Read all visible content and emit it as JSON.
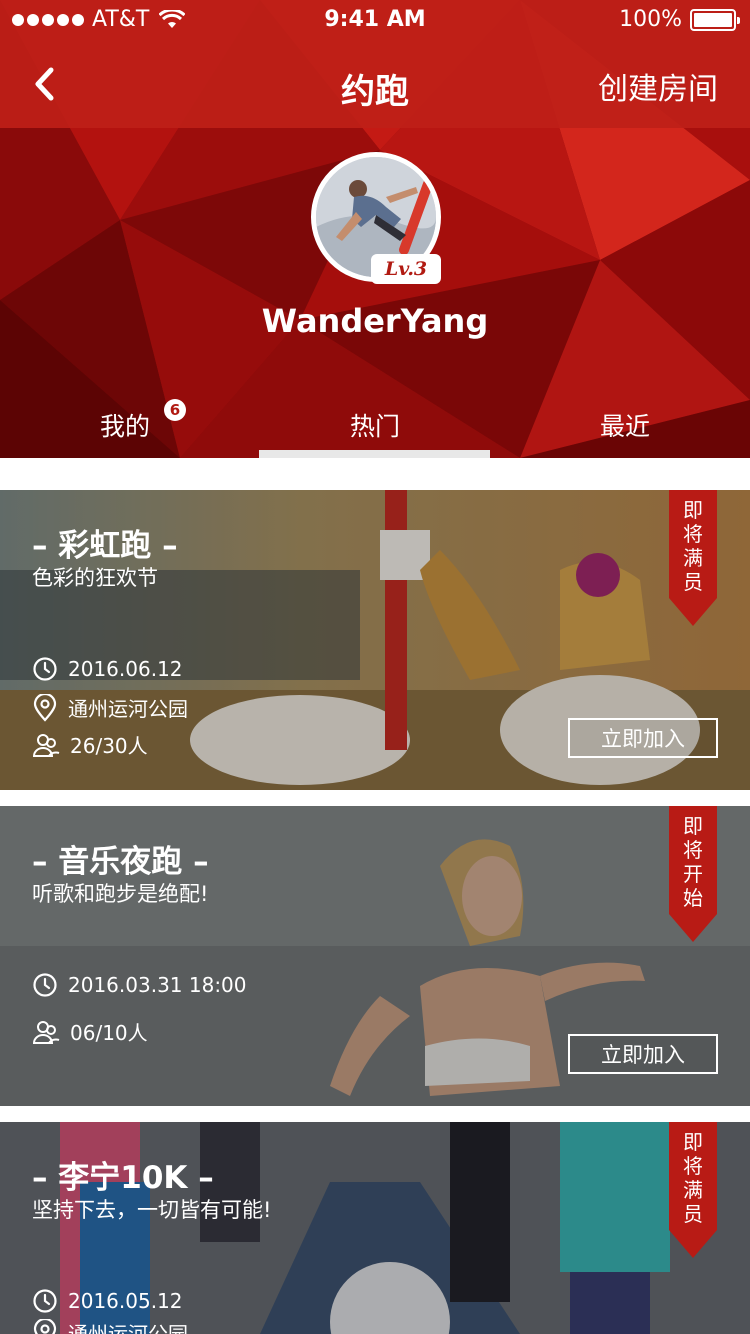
{
  "status_bar": {
    "carrier": "AT&T",
    "time": "9:41 AM",
    "battery": "100%",
    "battery_level": 1.0
  },
  "navbar": {
    "title": "约跑",
    "create_label": "创建房间"
  },
  "profile": {
    "username": "WanderYang",
    "level": "Lv.3"
  },
  "tabs": [
    {
      "label": "我的",
      "badge": "6"
    },
    {
      "label": "热门",
      "badge": ""
    },
    {
      "label": "最近",
      "badge": ""
    }
  ],
  "cards": [
    {
      "title": "– 彩虹跑 –",
      "subtitle": "色彩的狂欢节",
      "date": "2016.06.12",
      "location": "通州运河公园",
      "people": "26/30人",
      "button": "立即加入",
      "ribbon": "即\n将\n满\n员",
      "accent": "#b81b15"
    },
    {
      "title": "– 音乐夜跑 –",
      "subtitle": "听歌和跑步是绝配!",
      "date": "2016.03.31 18:00",
      "location": "",
      "people": "06/10人",
      "button": "立即加入",
      "ribbon": "即\n将\n开\n始",
      "accent": "#b81b15"
    },
    {
      "title": "– 李宁10K –",
      "subtitle": "坚持下去，一切皆有可能!",
      "date": "2016.05.12",
      "location": "通州运河公园",
      "people": "",
      "button": "",
      "ribbon": "即\n将\n满\n员",
      "accent": "#b81b15"
    }
  ],
  "icons": {
    "back": "chevron-left-icon",
    "clock": "clock-icon",
    "location": "location-pin-icon",
    "people": "group-icon",
    "wifi": "wifi-icon",
    "battery": "battery-icon"
  }
}
